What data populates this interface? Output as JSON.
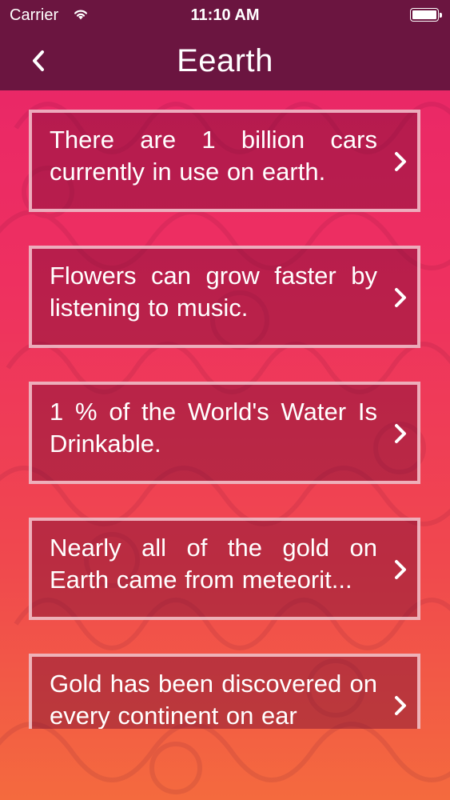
{
  "status_bar": {
    "carrier": "Carrier",
    "time": "11:10 AM"
  },
  "nav": {
    "title": "Eearth",
    "back_icon": "chevron-left-icon"
  },
  "facts": [
    {
      "text": "There are 1 billion cars currently in use on earth."
    },
    {
      "text": "Flowers can grow faster by listening to music."
    },
    {
      "text": "1 % of the World's Water Is Drinkable."
    },
    {
      "text": "Nearly all of the gold on Earth came from meteorit..."
    },
    {
      "text": "Gold has been discovered on every continent on ear"
    }
  ],
  "colors": {
    "navbar": "#6b1540",
    "gradient_top": "#e8246a",
    "gradient_bottom": "#f46a3e",
    "card_border": "#ffdce1"
  }
}
